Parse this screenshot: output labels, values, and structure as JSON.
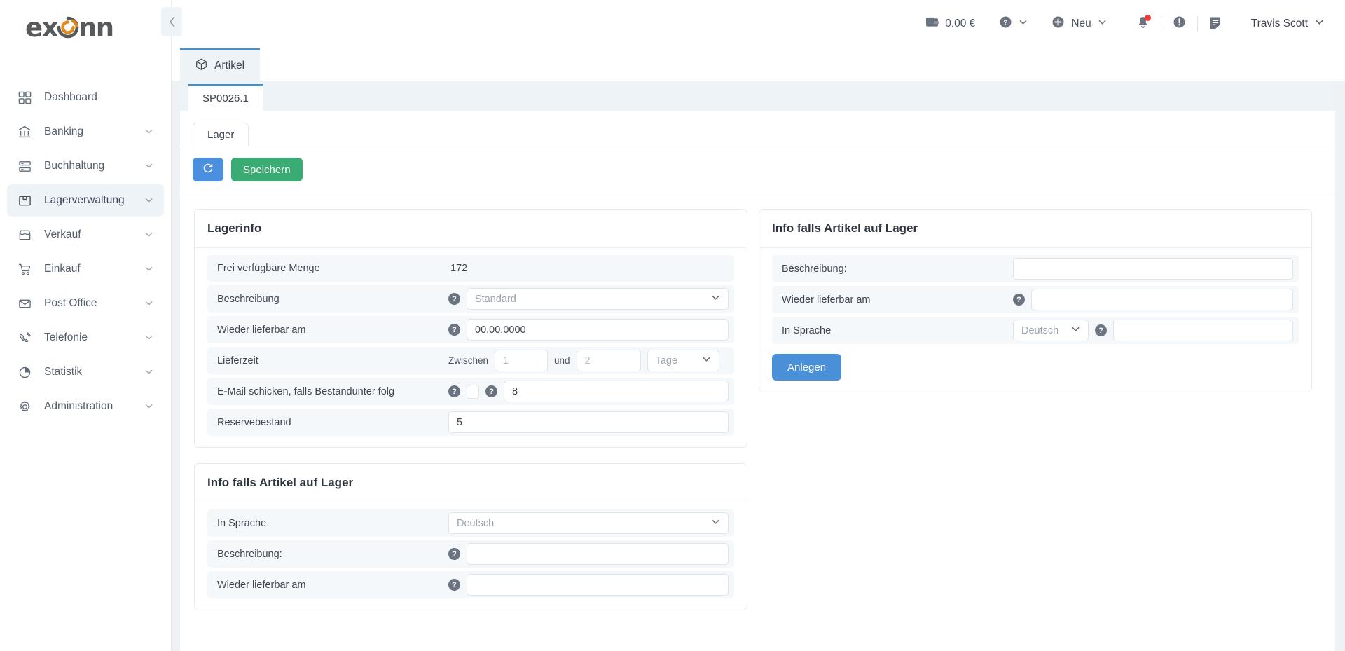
{
  "brand": {
    "name": "exonn",
    "accent": "#e08a1e",
    "gray": "#58595b"
  },
  "sidebar": {
    "items": [
      {
        "label": "Dashboard",
        "icon": "grid-icon",
        "chevron": false,
        "active": false
      },
      {
        "label": "Banking",
        "icon": "bank-icon",
        "chevron": true,
        "active": false
      },
      {
        "label": "Buchhaltung",
        "icon": "ledger-icon",
        "chevron": true,
        "active": false
      },
      {
        "label": "Lagerverwaltung",
        "icon": "box-icon",
        "chevron": true,
        "active": true
      },
      {
        "label": "Verkauf",
        "icon": "store-icon",
        "chevron": true,
        "active": false
      },
      {
        "label": "Einkauf",
        "icon": "cart-icon",
        "chevron": true,
        "active": false
      },
      {
        "label": "Post Office",
        "icon": "envelope-icon",
        "chevron": true,
        "active": false
      },
      {
        "label": "Telefonie",
        "icon": "phone-icon",
        "chevron": true,
        "active": false
      },
      {
        "label": "Statistik",
        "icon": "pie-chart-icon",
        "chevron": true,
        "active": false
      },
      {
        "label": "Administration",
        "icon": "gear-icon",
        "chevron": true,
        "active": false
      }
    ],
    "collapse_icon": "chevron-left-icon"
  },
  "topbar": {
    "balance": "0.00 €",
    "wallet_icon": "wallet-icon",
    "help_icon": "question-circle-icon",
    "new_label": "Neu",
    "new_icon": "plus-circle-icon",
    "bell_icon": "bell-icon",
    "alert_icon": "exclamation-circle-icon",
    "notes_icon": "note-icon",
    "user": "Travis Scott",
    "chevron_icon": "chevron-down-icon"
  },
  "tabs": {
    "module": {
      "label": "Artikel",
      "icon": "cube-icon"
    },
    "document": {
      "label": "SP0026.1"
    },
    "sub": {
      "label": "Lager"
    }
  },
  "toolbar": {
    "refresh_icon": "refresh-icon",
    "save_label": "Speichern"
  },
  "cards": {
    "lagerinfo": {
      "title": "Lagerinfo",
      "rows": {
        "menge": {
          "label": "Frei verfügbare Menge",
          "value": "172"
        },
        "beschreibung": {
          "label": "Beschreibung",
          "value": "Standard"
        },
        "wieder_lieferbar": {
          "label": "Wieder lieferbar am",
          "value": "00.00.0000"
        },
        "lieferzeit": {
          "label": "Lieferzeit",
          "between_label": "Zwischen",
          "and_label": "und",
          "from": "1",
          "to": "2",
          "unit": "Tage"
        },
        "email": {
          "label": "E-Mail schicken, falls Bestandunter folg",
          "value": "8",
          "checked": false
        },
        "reserve": {
          "label": "Reservebestand",
          "value": "5"
        }
      }
    },
    "info_left": {
      "title": "Info falls Artikel auf Lager",
      "rows": {
        "sprache": {
          "label": "In Sprache",
          "value": "Deutsch"
        },
        "beschreibung": {
          "label": "Beschreibung:",
          "value": ""
        },
        "wieder_lieferbar": {
          "label": "Wieder lieferbar am",
          "value": ""
        }
      }
    },
    "info_right": {
      "title": "Info falls Artikel auf Lager",
      "rows": {
        "beschreibung": {
          "label": "Beschreibung:",
          "value": ""
        },
        "wieder_lieferbar": {
          "label": "Wieder lieferbar am",
          "value": ""
        },
        "sprache": {
          "label": "In Sprache",
          "value": "Deutsch",
          "extra": ""
        }
      },
      "create_label": "Anlegen"
    }
  }
}
